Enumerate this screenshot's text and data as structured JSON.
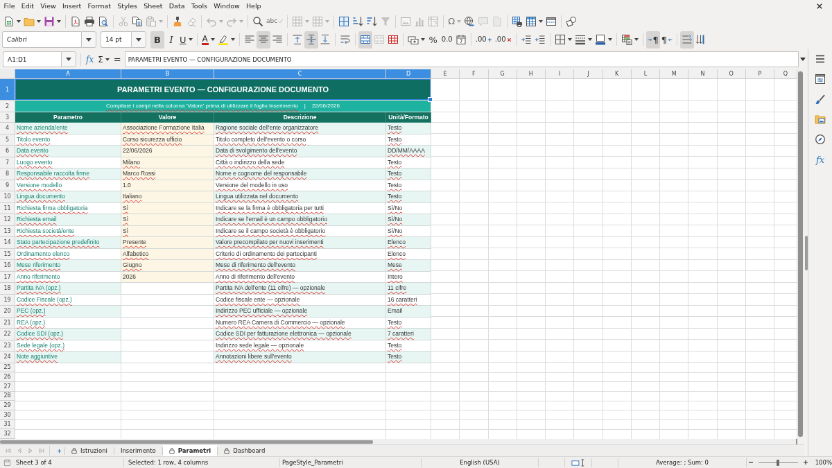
{
  "menu_bar": [
    "File",
    "Edit",
    "View",
    "Insert",
    "Format",
    "Styles",
    "Sheet",
    "Data",
    "Tools",
    "Window",
    "Help"
  ],
  "standard_toolbar": [
    {
      "disabled": false,
      "dropdown": true
    },
    {
      "disabled": false,
      "dropdown": true
    },
    {
      "disabled": false,
      "dropdown": true
    },
    {
      "disabled": false,
      "dropdown": false
    },
    {
      "disabled": false,
      "dropdown": false
    },
    {
      "disabled": false,
      "dropdown": false
    },
    {
      "disabled": true,
      "dropdown": false
    },
    {
      "disabled": false,
      "dropdown": false
    },
    {
      "disabled": true,
      "dropdown": true
    },
    {
      "disabled": false,
      "dropdown": false
    },
    {
      "disabled": true,
      "dropdown": false
    },
    {
      "disabled": true,
      "dropdown": true
    },
    {
      "disabled": true,
      "dropdown": true
    },
    {
      "disabled": false,
      "dropdown": false
    },
    {
      "label": "abc",
      "disabled": true,
      "dropdown": false
    },
    {
      "disabled": true,
      "dropdown": true
    },
    {
      "disabled": true,
      "dropdown": true
    },
    {
      "disabled": false,
      "dropdown": false
    },
    {
      "disabled": false,
      "dropdown": false
    },
    {
      "disabled": false,
      "dropdown": false
    },
    {
      "disabled": true,
      "dropdown": false
    },
    {
      "disabled": true,
      "dropdown": false
    },
    {
      "disabled": true,
      "dropdown": false
    },
    {
      "disabled": true,
      "dropdown": false
    },
    {
      "label": "Ω",
      "disabled": true,
      "dropdown": true
    },
    {
      "disabled": false,
      "dropdown": false
    },
    {
      "disabled": true,
      "dropdown": false
    },
    {
      "disabled": true,
      "dropdown": false
    },
    {
      "disabled": false,
      "dropdown": false
    },
    {
      "disabled": false,
      "dropdown": true
    },
    {
      "disabled": false,
      "dropdown": false
    },
    {
      "disabled": false,
      "dropdown": false
    }
  ],
  "formatting_toolbar": {
    "font_name": "Calibri",
    "font_size": "14 pt",
    "buttons": [
      {
        "label": "B",
        "on": true,
        "disabled": false,
        "dropdown": false
      },
      {
        "label": "I",
        "on": false,
        "disabled": false,
        "dropdown": false
      },
      {
        "label": "U",
        "on": false,
        "disabled": false,
        "dropdown": true
      },
      {
        "label": "A",
        "on": false,
        "disabled": false,
        "dropdown": true
      },
      {
        "on": false,
        "disabled": false,
        "dropdown": true
      },
      {
        "on": false,
        "disabled": false,
        "dropdown": false
      },
      {
        "on": true,
        "disabled": false,
        "dropdown": false
      },
      {
        "on": false,
        "disabled": false,
        "dropdown": false
      },
      {
        "on": false,
        "disabled": false,
        "dropdown": false
      },
      {
        "on": true,
        "disabled": false,
        "dropdown": false
      },
      {
        "on": false,
        "disabled": false,
        "dropdown": false
      },
      {
        "on": false,
        "disabled": false,
        "dropdown": false
      },
      {
        "on": true,
        "disabled": false,
        "dropdown": false
      },
      {
        "on": false,
        "disabled": true,
        "dropdown": false
      },
      {
        "on": false,
        "disabled": false,
        "dropdown": false
      },
      {
        "on": false,
        "disabled": false,
        "dropdown": true
      },
      {
        "label": "%",
        "on": false,
        "disabled": false,
        "dropdown": false
      },
      {
        "label": "0.0",
        "on": false,
        "disabled": false,
        "dropdown": false
      },
      {
        "on": false,
        "disabled": false,
        "dropdown": false
      },
      {
        "label": ".00",
        "on": false,
        "disabled": false,
        "dropdown": false
      },
      {
        "label": ".00",
        "on": false,
        "disabled": false,
        "dropdown": false
      },
      {
        "on": false,
        "disabled": false,
        "dropdown": false
      },
      {
        "on": false,
        "disabled": false,
        "dropdown": false
      },
      {
        "on": false,
        "disabled": false,
        "dropdown": true
      },
      {
        "on": false,
        "disabled": false,
        "dropdown": true
      },
      {
        "on": false,
        "disabled": false,
        "dropdown": true
      },
      {
        "on": false,
        "disabled": false,
        "dropdown": true
      },
      {
        "label": "¶",
        "on": true,
        "disabled": false,
        "dropdown": false
      },
      {
        "label": "¶",
        "on": false,
        "disabled": false,
        "dropdown": false
      },
      {
        "on": true,
        "disabled": false,
        "dropdown": false
      },
      {
        "on": false,
        "disabled": false,
        "dropdown": false
      }
    ]
  },
  "formula_bar": {
    "name_box": "A1:D1",
    "function_wizard": "fx",
    "sum": "Σ",
    "equals": "=",
    "content": "PARAMETRI EVENTO — CONFIGURAZIONE DOCUMENTO"
  },
  "sheet": {
    "columns": [
      {
        "label": "A",
        "selected": true
      },
      {
        "label": "B",
        "selected": true
      },
      {
        "label": "C",
        "selected": true
      },
      {
        "label": "D",
        "selected": true
      },
      {
        "label": "E",
        "selected": false
      },
      {
        "label": "F",
        "selected": false
      },
      {
        "label": "G",
        "selected": false
      },
      {
        "label": "H",
        "selected": false
      },
      {
        "label": "I",
        "selected": false
      },
      {
        "label": "J",
        "selected": false
      },
      {
        "label": "K",
        "selected": false
      },
      {
        "label": "L",
        "selected": false
      },
      {
        "label": "M",
        "selected": false
      },
      {
        "label": "N",
        "selected": false
      },
      {
        "label": "O",
        "selected": false
      },
      {
        "label": "P",
        "selected": false
      },
      {
        "label": "Q",
        "selected": false
      }
    ],
    "title_row": {
      "row": "1",
      "selected": true,
      "text": "PARAMETRI EVENTO — CONFIGURAZIONE DOCUMENTO"
    },
    "note_row": {
      "row": "2",
      "selected": false,
      "note": "Compilare i campi nella colonna 'Valore' prima di utilizzare il foglio Inserimento",
      "note_spell_flagged": true,
      "separator": "|",
      "date": "22/06/2026"
    },
    "header_row": {
      "row": "3",
      "selected": false,
      "cells": [
        "Parametro",
        "Valore",
        "Descrizione",
        "Unità/Formato"
      ]
    },
    "rows": [
      {
        "row": "4",
        "selected": false,
        "banded": true,
        "cells": [
          {
            "text": "Nome azienda/ente",
            "spell_flagged": true,
            "highlighted": false
          },
          {
            "text": "Associazione Formazione Italia",
            "spell_flagged": true,
            "highlighted": true
          },
          {
            "text": "Ragione sociale dell'ente organizzatore",
            "spell_flagged": true,
            "highlighted": false
          },
          {
            "text": "Testo",
            "spell_flagged": true,
            "highlighted": false
          }
        ]
      },
      {
        "row": "5",
        "selected": false,
        "banded": false,
        "cells": [
          {
            "text": "Titolo evento",
            "spell_flagged": true,
            "highlighted": false
          },
          {
            "text": "Corso sicurezza ufficio",
            "spell_flagged": true,
            "highlighted": true
          },
          {
            "text": "Titolo completo dell'evento o corso",
            "spell_flagged": true,
            "highlighted": false
          },
          {
            "text": "Testo",
            "spell_flagged": true,
            "highlighted": false
          }
        ]
      },
      {
        "row": "6",
        "selected": false,
        "banded": true,
        "cells": [
          {
            "text": "Data evento",
            "spell_flagged": true,
            "highlighted": false
          },
          {
            "text": "22/06/2026",
            "spell_flagged": false,
            "highlighted": true
          },
          {
            "text": "Data di svolgimento dell'evento",
            "spell_flagged": true,
            "highlighted": false
          },
          {
            "text": "DD/MM/AAAA",
            "spell_flagged": true,
            "highlighted": false
          }
        ]
      },
      {
        "row": "7",
        "selected": false,
        "banded": false,
        "cells": [
          {
            "text": "Luogo evento",
            "spell_flagged": true,
            "highlighted": false
          },
          {
            "text": "Milano",
            "spell_flagged": true,
            "highlighted": true
          },
          {
            "text": "Città o indirizzo della sede",
            "spell_flagged": true,
            "highlighted": false
          },
          {
            "text": "Testo",
            "spell_flagged": true,
            "highlighted": false
          }
        ]
      },
      {
        "row": "8",
        "selected": false,
        "banded": true,
        "cells": [
          {
            "text": "Responsabile raccolta firme",
            "spell_flagged": true,
            "highlighted": false
          },
          {
            "text": "Marco Rossi",
            "spell_flagged": true,
            "highlighted": true
          },
          {
            "text": "Nome e cognome del responsabile",
            "spell_flagged": true,
            "highlighted": false
          },
          {
            "text": "Testo",
            "spell_flagged": true,
            "highlighted": false
          }
        ]
      },
      {
        "row": "9",
        "selected": false,
        "banded": false,
        "cells": [
          {
            "text": "Versione modello",
            "spell_flagged": true,
            "highlighted": false
          },
          {
            "text": "1.0",
            "spell_flagged": false,
            "highlighted": true
          },
          {
            "text": "Versione del modello in uso",
            "spell_flagged": true,
            "highlighted": false
          },
          {
            "text": "Testo",
            "spell_flagged": true,
            "highlighted": false
          }
        ]
      },
      {
        "row": "10",
        "selected": false,
        "banded": true,
        "cells": [
          {
            "text": "Lingua documento",
            "spell_flagged": true,
            "highlighted": false
          },
          {
            "text": "Italiano",
            "spell_flagged": true,
            "highlighted": true
          },
          {
            "text": "Lingua utilizzata nel documento",
            "spell_flagged": true,
            "highlighted": false
          },
          {
            "text": "Testo",
            "spell_flagged": true,
            "highlighted": false
          }
        ]
      },
      {
        "row": "11",
        "selected": false,
        "banded": false,
        "cells": [
          {
            "text": "Richiesta firma obbligatoria",
            "spell_flagged": true,
            "highlighted": false
          },
          {
            "text": "Sì",
            "spell_flagged": true,
            "highlighted": true
          },
          {
            "text": "Indicare se la firma è obbligatoria per tutti",
            "spell_flagged": true,
            "highlighted": false
          },
          {
            "text": "Sì/No",
            "spell_flagged": true,
            "highlighted": false
          }
        ]
      },
      {
        "row": "12",
        "selected": false,
        "banded": true,
        "cells": [
          {
            "text": "Richiesta email",
            "spell_flagged": true,
            "highlighted": false
          },
          {
            "text": "Sì",
            "spell_flagged": true,
            "highlighted": true
          },
          {
            "text": "Indicare se l'email è un campo obbligatorio",
            "spell_flagged": true,
            "highlighted": false
          },
          {
            "text": "Sì/No",
            "spell_flagged": true,
            "highlighted": false
          }
        ]
      },
      {
        "row": "13",
        "selected": false,
        "banded": false,
        "cells": [
          {
            "text": "Richiesta società/ente",
            "spell_flagged": true,
            "highlighted": false
          },
          {
            "text": "Sì",
            "spell_flagged": true,
            "highlighted": true
          },
          {
            "text": "Indicare se il campo società è obbligatorio",
            "spell_flagged": true,
            "highlighted": false
          },
          {
            "text": "Sì/No",
            "spell_flagged": true,
            "highlighted": false
          }
        ]
      },
      {
        "row": "14",
        "selected": false,
        "banded": true,
        "cells": [
          {
            "text": "Stato partecipazione predefinito",
            "spell_flagged": true,
            "highlighted": false
          },
          {
            "text": "Presente",
            "spell_flagged": true,
            "highlighted": true
          },
          {
            "text": "Valore precompilato per nuovi inserimenti",
            "spell_flagged": true,
            "highlighted": false
          },
          {
            "text": "Elenco",
            "spell_flagged": true,
            "highlighted": false
          }
        ]
      },
      {
        "row": "15",
        "selected": false,
        "banded": false,
        "cells": [
          {
            "text": "Ordinamento elenco",
            "spell_flagged": true,
            "highlighted": false
          },
          {
            "text": "Alfabetico",
            "spell_flagged": true,
            "highlighted": true
          },
          {
            "text": "Criterio di ordinamento dei partecipanti",
            "spell_flagged": true,
            "highlighted": false
          },
          {
            "text": "Elenco",
            "spell_flagged": true,
            "highlighted": false
          }
        ]
      },
      {
        "row": "16",
        "selected": false,
        "banded": true,
        "cells": [
          {
            "text": "Mese riferimento",
            "spell_flagged": true,
            "highlighted": false
          },
          {
            "text": "Giugno",
            "spell_flagged": true,
            "highlighted": true
          },
          {
            "text": "Mese di riferimento dell'evento",
            "spell_flagged": true,
            "highlighted": false
          },
          {
            "text": "Mese",
            "spell_flagged": true,
            "highlighted": false
          }
        ]
      },
      {
        "row": "17",
        "selected": false,
        "banded": false,
        "cells": [
          {
            "text": "Anno riferimento",
            "spell_flagged": true,
            "highlighted": false
          },
          {
            "text": "2026",
            "spell_flagged": false,
            "highlighted": true
          },
          {
            "text": "Anno di riferimento dell'evento",
            "spell_flagged": true,
            "highlighted": false
          },
          {
            "text": "Intero",
            "spell_flagged": true,
            "highlighted": false
          }
        ]
      },
      {
        "row": "18",
        "selected": false,
        "banded": true,
        "cells": [
          {
            "text": "Partita IVA (opz.)",
            "spell_flagged": true,
            "highlighted": false
          },
          {
            "highlighted": false
          },
          {
            "text": "Partita IVA dell'ente (11 cifre) — opzionale",
            "spell_flagged": true,
            "highlighted": false
          },
          {
            "text": "11 cifre",
            "spell_flagged": true,
            "highlighted": false
          }
        ]
      },
      {
        "row": "19",
        "selected": false,
        "banded": false,
        "cells": [
          {
            "text": "Codice Fiscale (opz.)",
            "spell_flagged": true,
            "highlighted": false
          },
          {
            "highlighted": false
          },
          {
            "text": "Codice fiscale ente — opzionale",
            "spell_flagged": true,
            "highlighted": false
          },
          {
            "text": "16 caratteri",
            "spell_flagged": true,
            "highlighted": false
          }
        ]
      },
      {
        "row": "20",
        "selected": false,
        "banded": true,
        "cells": [
          {
            "text": "PEC (opz.)",
            "spell_flagged": true,
            "highlighted": false
          },
          {
            "highlighted": false
          },
          {
            "text": "Indirizzo PEC ufficiale — opzionale",
            "spell_flagged": true,
            "highlighted": false
          },
          {
            "text": "Email",
            "spell_flagged": false,
            "highlighted": false
          }
        ]
      },
      {
        "row": "21",
        "selected": false,
        "banded": false,
        "cells": [
          {
            "text": "REA (opz.)",
            "spell_flagged": true,
            "highlighted": false
          },
          {
            "highlighted": false
          },
          {
            "text": "Numero REA Camera di Commercio — opzionale",
            "spell_flagged": true,
            "highlighted": false
          },
          {
            "text": "Testo",
            "spell_flagged": true,
            "highlighted": false
          }
        ]
      },
      {
        "row": "22",
        "selected": false,
        "banded": true,
        "cells": [
          {
            "text": "Codice SDI (opz.)",
            "spell_flagged": true,
            "highlighted": false
          },
          {
            "highlighted": false
          },
          {
            "text": "Codice SDI per fatturazione elettronica — opzionale",
            "spell_flagged": true,
            "highlighted": false
          },
          {
            "text": "7 caratteri",
            "spell_flagged": true,
            "highlighted": false
          }
        ]
      },
      {
        "row": "23",
        "selected": false,
        "banded": false,
        "cells": [
          {
            "text": "Sede legale (opz.)",
            "spell_flagged": true,
            "highlighted": false
          },
          {
            "highlighted": false
          },
          {
            "text": "Indirizzo sede legale — opzionale",
            "spell_flagged": true,
            "highlighted": false
          },
          {
            "text": "Testo",
            "spell_flagged": true,
            "highlighted": false
          }
        ]
      },
      {
        "row": "24",
        "selected": false,
        "banded": true,
        "cells": [
          {
            "text": "Note aggiuntive",
            "spell_flagged": true,
            "highlighted": false
          },
          {
            "highlighted": false
          },
          {
            "text": "Annotazioni libere sull'evento",
            "spell_flagged": true,
            "highlighted": false
          },
          {
            "text": "Testo",
            "spell_flagged": true,
            "highlighted": false
          }
        ]
      }
    ],
    "empty_rows": [
      {
        "row": "25",
        "selected": false
      },
      {
        "row": "26",
        "selected": false
      },
      {
        "row": "27",
        "selected": false
      },
      {
        "row": "28",
        "selected": false
      },
      {
        "row": "29",
        "selected": false
      },
      {
        "row": "30",
        "selected": false
      },
      {
        "row": "31",
        "selected": false
      },
      {
        "row": "32",
        "selected": false
      }
    ]
  },
  "sheet_tabs": [
    {
      "label": "Istruzioni",
      "locked": true,
      "selected": false
    },
    {
      "label": "Inserimento",
      "locked": false,
      "selected": false
    },
    {
      "label": "Parametri",
      "locked": true,
      "selected": true
    },
    {
      "label": "Dashboard",
      "locked": true,
      "selected": false
    }
  ],
  "status_bar": {
    "sheet": "Sheet 3 of 4",
    "selection": "Selected: 1 row, 4 columns",
    "page_style": "PageStyle_Parametri",
    "language": "English (USA)",
    "summary": "Average: ; Sum: 0",
    "zoom": {
      "level": 0.5,
      "label": "100%"
    }
  },
  "sidebar": {
    "functions": "fx"
  }
}
